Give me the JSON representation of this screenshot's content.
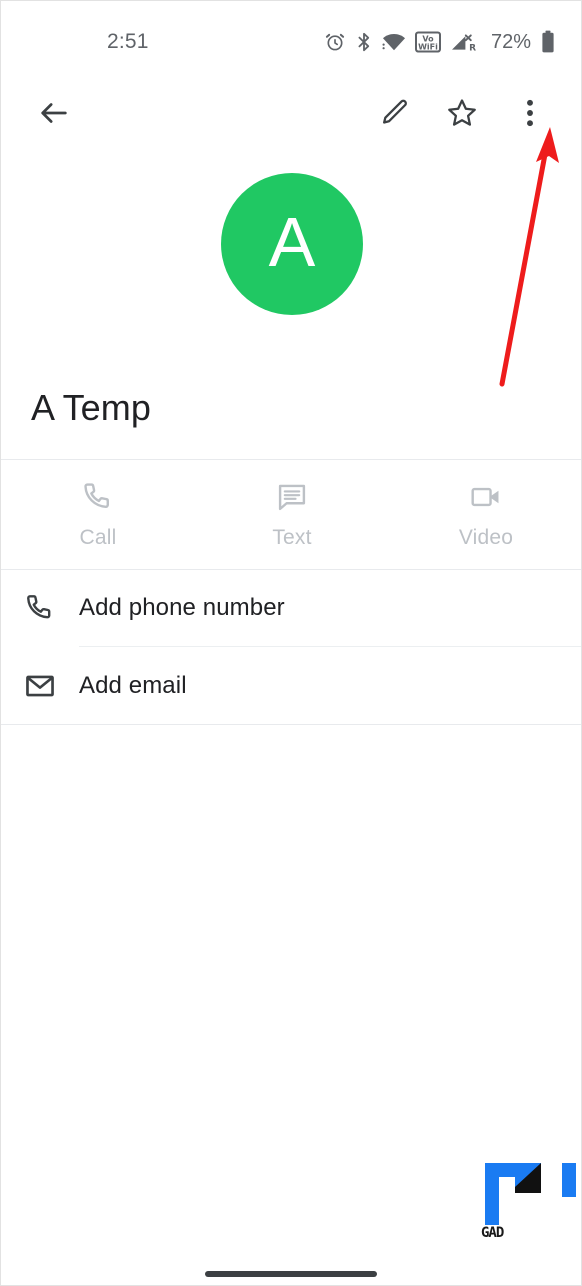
{
  "status_bar": {
    "time": "2:51",
    "battery_percent": "72%",
    "icons": [
      "alarm-icon",
      "bluetooth-icon",
      "wifi-icon",
      "vowifi-icon",
      "signal-no-sim-roaming-icon",
      "battery-icon"
    ]
  },
  "toolbar": {
    "back_label": "Back",
    "edit_label": "Edit contact",
    "star_label": "Add to favorites",
    "more_label": "More options"
  },
  "contact": {
    "avatar_initial": "A",
    "avatar_color": "#20c863",
    "name": "A Temp"
  },
  "quick_actions": [
    {
      "id": "call",
      "label": "Call",
      "icon": "phone-icon",
      "enabled": false
    },
    {
      "id": "text",
      "label": "Text",
      "icon": "message-icon",
      "enabled": false
    },
    {
      "id": "video",
      "label": "Video",
      "icon": "video-camera-icon",
      "enabled": false
    }
  ],
  "detail_rows": [
    {
      "id": "add-phone",
      "label": "Add phone number",
      "icon": "phone-icon"
    },
    {
      "id": "add-email",
      "label": "Add email",
      "icon": "envelope-icon"
    }
  ],
  "annotation": {
    "type": "arrow",
    "color": "#ee1c1c",
    "points_to": "more-options-button"
  },
  "watermark": {
    "text": "GAD",
    "primary_color": "#1a7bf2",
    "secondary_color": "#111111"
  },
  "navigation": {
    "home_indicator": "gesture-home-bar"
  }
}
